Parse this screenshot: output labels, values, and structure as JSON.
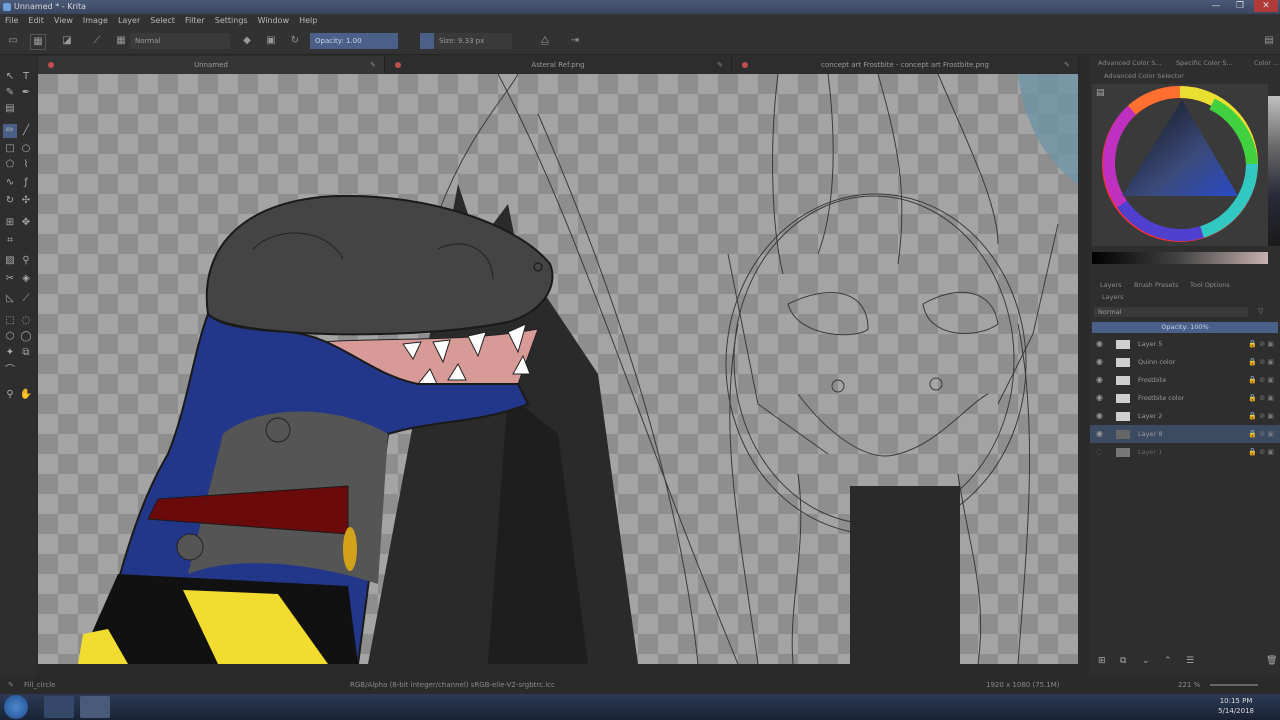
{
  "window": {
    "title": "Unnamed * - Krita",
    "controls": [
      "—",
      "❐",
      "✕"
    ]
  },
  "menu": [
    "File",
    "Edit",
    "View",
    "Image",
    "Layer",
    "Select",
    "Filter",
    "Settings",
    "Window",
    "Help"
  ],
  "toolbar": {
    "blend_mode": "Normal",
    "opacity": "Opacity: 1.00",
    "size": "Size: 9.33 px"
  },
  "tabs": [
    {
      "label": "Unnamed"
    },
    {
      "label": "Asteral Ref.png"
    },
    {
      "label": "concept art Frostbite - concept art Frostbite.png"
    }
  ],
  "right_panel": {
    "docker_tabs": [
      "Advanced Color S...",
      "Specific Color S...",
      "Color ..."
    ],
    "color_selector_title": "Advanced Color Selector",
    "layer_tabs": [
      "Layers",
      "Brush Presets",
      "Tool Options"
    ],
    "layers_title": "Layers",
    "blend_mode": "Normal",
    "opacity": "Opacity: 100%",
    "layers": [
      {
        "name": "Layer 5",
        "selected": false
      },
      {
        "name": "Quinn color",
        "selected": false
      },
      {
        "name": "Frostbite",
        "selected": false
      },
      {
        "name": "Frostbite color",
        "selected": false
      },
      {
        "name": "Layer 2",
        "selected": false
      },
      {
        "name": "Layer 8",
        "selected": true
      },
      {
        "name": "Layer 1",
        "selected": false
      }
    ]
  },
  "status": {
    "tool": "Fill_circle",
    "color_info": "RGB/Alpha (8-bit integer/channel)  sRGB-elle-V2-srgbtrc.icc",
    "dimensions": "1920 x 1080 (75.1M)",
    "zoom": "221 %"
  },
  "taskbar": {
    "time": "10:15 PM",
    "date": "5/14/2018"
  },
  "colors": {
    "accent": "#3c4a62",
    "panel": "#2e2e2e",
    "canvas_checker": "#8e8e8e"
  }
}
